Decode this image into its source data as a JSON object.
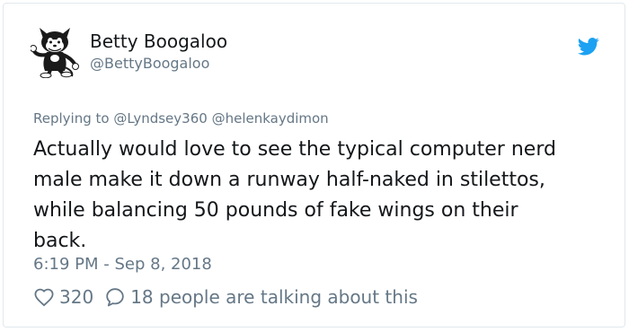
{
  "tweet": {
    "author": {
      "display_name": "Betty Boogaloo",
      "handle": "@BettyBoogaloo",
      "avatar_icon": "felix-the-cat-icon"
    },
    "platform_icon": "twitter-bird-icon",
    "brand_color": "#1da1f2",
    "replying_to": {
      "prefix": "Replying to",
      "mentions": [
        "@Lyndsey360",
        "@helenkaydimon"
      ]
    },
    "text_lines": [
      "Actually would love to see the typical computer nerd",
      "male make it down a runway half-naked in stilettos,",
      "while balancing 50 pounds of fake wings on their",
      "back."
    ],
    "timestamp": "6:19 PM - Sep 8, 2018",
    "stats": {
      "likes": "320",
      "talking": "18 people are talking about this"
    }
  }
}
